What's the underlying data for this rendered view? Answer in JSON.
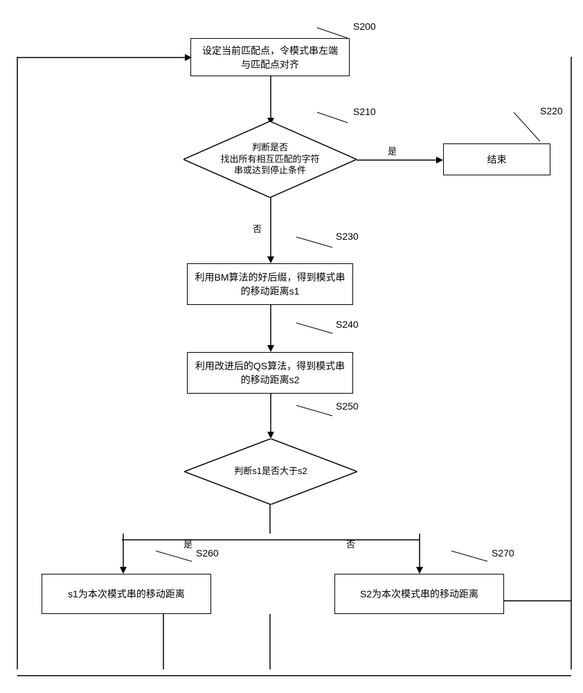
{
  "steps": {
    "s200": {
      "label": "S200",
      "text": "设定当前匹配点，令模式串左端与匹配点对齐"
    },
    "s210": {
      "label": "S210",
      "text_l1": "判断是否",
      "text_l2": "找出所有相互匹配的字符",
      "text_l3": "串或达到停止条件"
    },
    "s220": {
      "label": "S220",
      "text": "结束"
    },
    "s230": {
      "label": "S230",
      "text": "利用BM算法的好后缀，得到模式串的移动距离s1"
    },
    "s240": {
      "label": "S240",
      "text": "利用改进后的QS算法，得到模式串的移动距离s2"
    },
    "s250": {
      "label": "S250",
      "text": "判断s1是否大于s2"
    },
    "s260": {
      "label": "S260",
      "text": "s1为本次模式串的移动距离"
    },
    "s270": {
      "label": "S270",
      "text": "S2为本次模式串的移动距离"
    }
  },
  "labels": {
    "yes": "是",
    "no": "否"
  }
}
